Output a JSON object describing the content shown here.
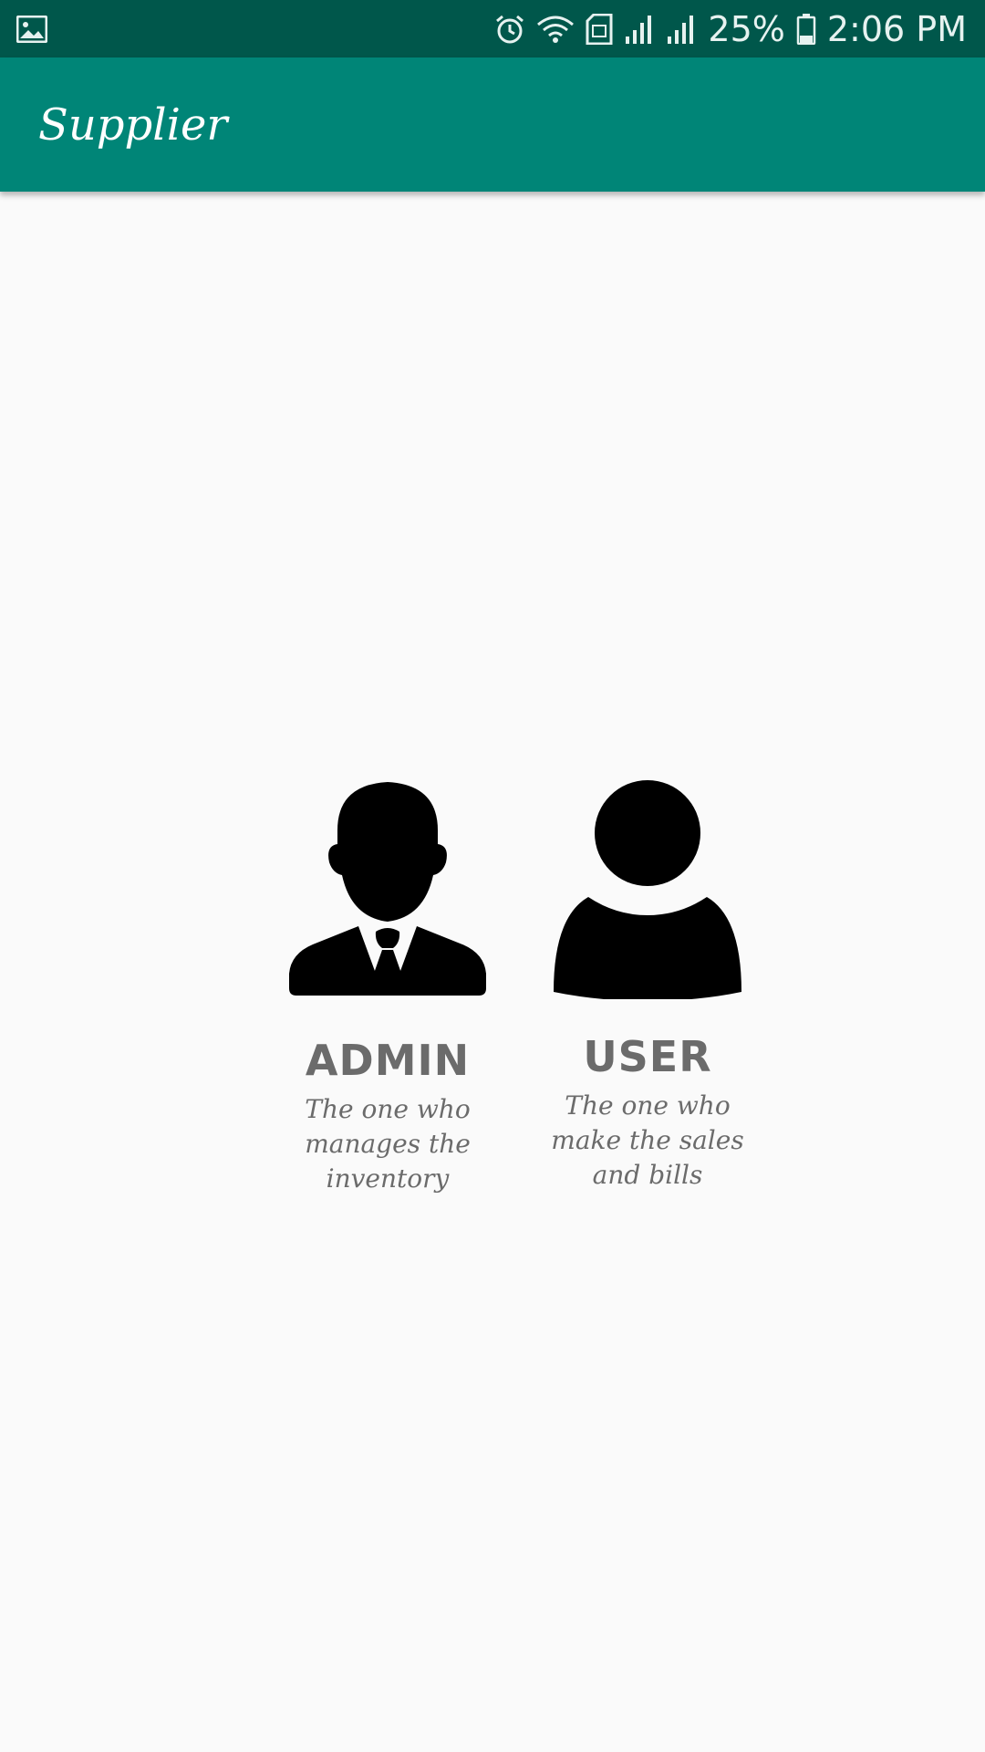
{
  "status_bar": {
    "battery": "25%",
    "time": "2:06 PM",
    "icons": [
      "gallery-icon",
      "alarm-icon",
      "wifi-icon",
      "sim-icon",
      "signal-icon",
      "signal-icon",
      "battery-icon"
    ]
  },
  "app_bar": {
    "title": "Supplier",
    "color": "#008577",
    "status_color": "#00574b"
  },
  "roles": {
    "admin": {
      "icon": "businessman-icon",
      "title": "ADMIN",
      "description": "The one who manages the inventory"
    },
    "user": {
      "icon": "person-icon",
      "title": "USER",
      "description": "The one who make the sales and bills"
    }
  }
}
